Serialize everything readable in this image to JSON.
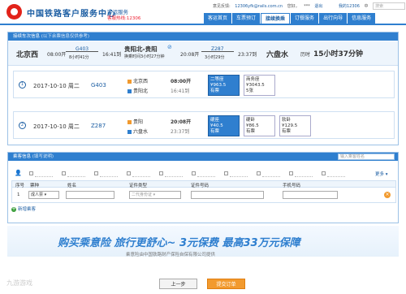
{
  "header": {
    "logo_title": "中国铁路客户服务中心",
    "site_sub": "客运服务",
    "hotline": "客服热线:12306",
    "topbar": {
      "feedback": "意见反馈:",
      "email": "12306yfk@rails.com.cn",
      "hello": "您好，",
      "user": "***",
      "logout": "退出",
      "my12306": "我的12306",
      "lang": "中",
      "search_placeholder": "搜索"
    }
  },
  "nav": [
    "客运首页",
    "车票预订",
    "接续换乘",
    "订餐服务",
    "出行向导",
    "信息服务"
  ],
  "train_panel": {
    "title": "接续车次信息",
    "note": "(以下余票信息仅供参考)",
    "summary": {
      "from": "北京西",
      "dep_time": "08:00开",
      "train1": "G403",
      "dur1": "8小时41分",
      "arr1": "16:41到",
      "transfer": "贵阳北-贵阳",
      "transfer_note": "换乘时间3小时27分钟",
      "dep2": "20:08开",
      "train2": "Z287",
      "dur2": "3小时29分",
      "arr2": "23:37到",
      "to": "六盘水",
      "total_label": "历时",
      "total": "15小时37分钟"
    },
    "legs": [
      {
        "num": "1",
        "date": "2017-10-10 周二",
        "train": "G403",
        "from": "北京西",
        "from_time": "08:00开",
        "to": "贵阳北",
        "to_time": "16:41到",
        "seats": [
          {
            "label": "二等座",
            "price": "¥963.5",
            "stock": "有票"
          },
          {
            "label": "商务座",
            "price": "¥3043.5",
            "stock": "5张"
          }
        ]
      },
      {
        "num": "2",
        "date": "2017-10-10 周二",
        "train": "Z287",
        "from": "贵阳",
        "from_time": "20:08开",
        "to": "六盘水",
        "to_time": "23:37到",
        "seats": [
          {
            "label": "硬座",
            "price": "¥40.5",
            "stock": "有票"
          },
          {
            "label": "硬卧",
            "price": "¥86.5",
            "stock": "有票"
          },
          {
            "label": "软卧",
            "price": "¥129.5",
            "stock": "有票"
          }
        ]
      }
    ]
  },
  "passenger_panel": {
    "title": "乘客信息",
    "note": "(填写说明)",
    "search_placeholder": "输入乘客姓名",
    "more": "更多",
    "columns": [
      "序号",
      "票种",
      "姓名",
      "证件类型",
      "证件号码",
      "手机号码"
    ],
    "row": {
      "idx": "1",
      "ticket_type": "成人票",
      "id_type": "二代身份证"
    },
    "add": "新增乘客"
  },
  "banner": {
    "slogan": "购买乘意险  旅行更舒心~    3元保费  最高33万元保障",
    "provider": "乘意险由中国铁路财产保险自保有限公司提供"
  },
  "footer": {
    "watermark": "九游游戏",
    "prev": "上一步",
    "submit": "提交订单"
  },
  "colors": {
    "brand_blue": "#2f7fcf",
    "accent_orange": "#f29a2e",
    "brand_red": "#e2231a"
  }
}
